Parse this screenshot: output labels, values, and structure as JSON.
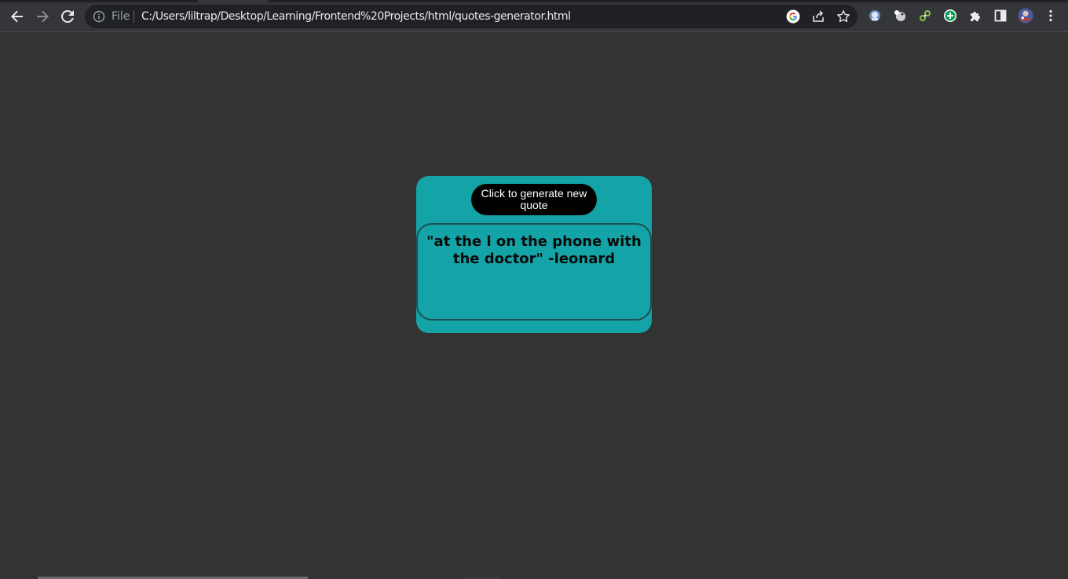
{
  "browser": {
    "file_label": "File",
    "url": "C:/Users/liltrap/Desktop/Learning/Frontend%20Projects/html/quotes-generator.html",
    "icons": {
      "back": "back-arrow-icon",
      "forward": "forward-arrow-icon",
      "reload": "reload-icon",
      "info": "info-icon",
      "google": "google-icon",
      "share": "share-icon",
      "bookmark": "star-icon",
      "extensions": [
        "extension-icon-1",
        "extension-icon-2",
        "extension-icon-3",
        "extension-icon-4"
      ],
      "puzzle": "puzzle-icon",
      "sidepanel": "side-panel-icon",
      "profile": "avatar",
      "menu": "kebab-menu-icon"
    }
  },
  "page": {
    "button_label": "Click to generate new quote",
    "quote": "\"at the l on the phone with the doctor\" -leonard"
  },
  "colors": {
    "background": "#333333",
    "card": "#14a3a6",
    "button": "#000000",
    "quote_border": "#1f4f52"
  }
}
